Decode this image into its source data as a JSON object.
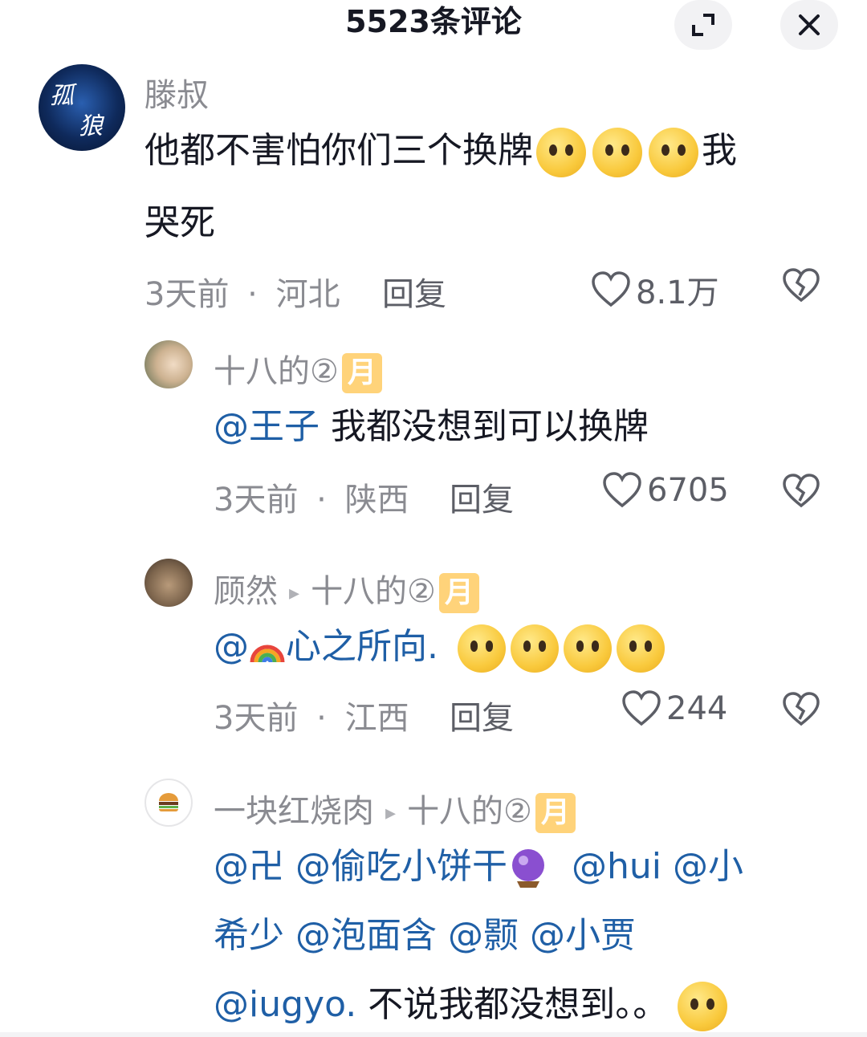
{
  "header": {
    "title": "5523条评论",
    "expand_icon": "expand-icon",
    "close_icon": "close-icon"
  },
  "comments": [
    {
      "username": "滕叔",
      "avatar_text": [
        "孤",
        "狼"
      ],
      "text_line1": "他都不害怕你们三个换牌",
      "text_line1_after": "我",
      "text_line2": "哭死",
      "time": "3天前",
      "dot": "·",
      "location": "河北",
      "reply_label": "回复",
      "likes": "8.1万"
    }
  ],
  "replies": [
    {
      "username": "十八的②",
      "badge": "月",
      "mention": "@王子",
      "text": " 我都没想到可以换牌",
      "time": "3天前",
      "dot": "·",
      "location": "陕西",
      "reply_label": "回复",
      "likes": "6705"
    },
    {
      "username": "顾然",
      "reply_to": "十八的②",
      "badge": "月",
      "mention_prefix": "@",
      "mention_name": "心之所向.",
      "time": "3天前",
      "dot": "·",
      "location": "江西",
      "reply_label": "回复",
      "likes": "244"
    },
    {
      "username": "一块红烧肉",
      "reply_to": "十八的②",
      "badge": "月",
      "line1_mentions": [
        "@卍",
        "@偷吃小饼干"
      ],
      "line1_tail": "@hui @小",
      "line2": "希少 @泡面含 @颢 @小贾",
      "line3_mention": "@iugyo.",
      "line3_text": " 不说我都没想到。。"
    }
  ],
  "colors": {
    "mention": "#1f5fa6",
    "meta": "#8a8b91",
    "badge": "#ffd37a"
  }
}
